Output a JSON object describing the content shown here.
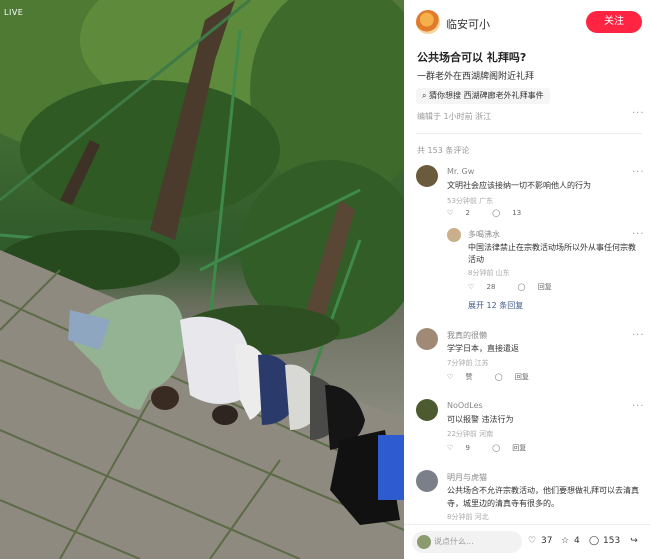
{
  "photo": {
    "badge": "LIVE"
  },
  "author": {
    "name": "临安可小",
    "follow_label": "关注"
  },
  "post": {
    "title": "公共场合可以 礼拜吗?",
    "subtitle": "一群老外在西湖牌阁附近礼拜",
    "tag_prefix": "猜你想搜",
    "tag_text": "西湖碑廊老外礼拜事件",
    "meta": "编辑于 1小时前 浙江"
  },
  "comments_header": "共 153 条评论",
  "comments": [
    {
      "name": "Mr. Gw",
      "text": "文明社会应该接纳一切不影响他人的行为",
      "meta": "53分钟前 广东",
      "likes": "2",
      "replies": "13",
      "sub": {
        "name": "多喝沸水",
        "text_line1": "中国法律禁止在宗教活动场所以外从事任何宗教",
        "text_line2": "活动",
        "meta": "8分钟前 山东",
        "likes": "28",
        "reply_label": "回复"
      },
      "expand": "展开 12 条回复"
    },
    {
      "name": "我真的很懒",
      "text": "学学日本，直接遣返",
      "meta": "7分钟前 江苏",
      "likes": "赞",
      "reply_label": "回复"
    },
    {
      "name": "NoOdLes",
      "text": "可以报警 违法行为",
      "meta": "22分钟前 河南",
      "likes": "9",
      "reply_label": "回复"
    },
    {
      "name": "明月与虎猫",
      "text_line1": "公共场合不允许宗教活动，他们要想做礼拜可以去清真",
      "text_line2": "寺，城里边的清真寺有很多的。",
      "meta": "8分钟前 河北"
    }
  ],
  "bottom": {
    "input_placeholder": "说点什么...",
    "likes": "37",
    "stars": "4",
    "comments": "153"
  },
  "icons": [
    "search-icon",
    "heart-icon",
    "reply-icon",
    "star-icon",
    "comment-icon",
    "share-icon",
    "more-icon"
  ]
}
